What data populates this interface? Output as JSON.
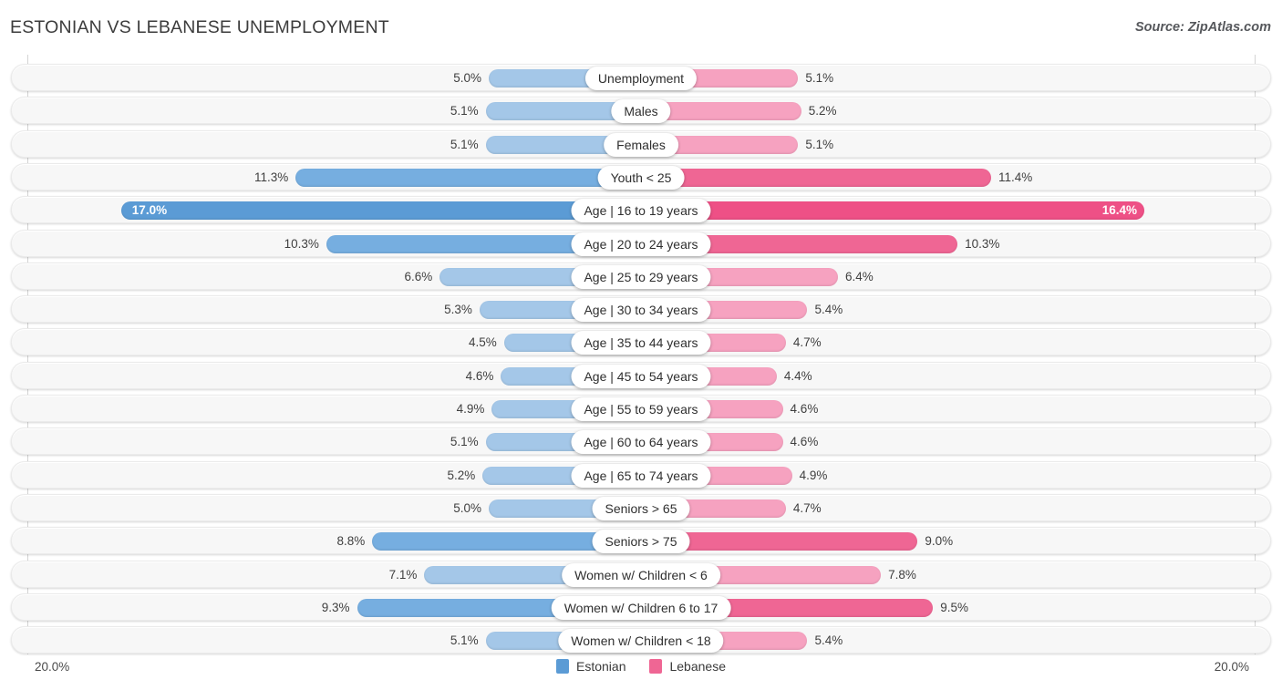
{
  "header": {
    "title": "ESTONIAN VS LEBANESE UNEMPLOYMENT",
    "source": "Source: ZipAtlas.com"
  },
  "axis": {
    "left_tick": "20.0%",
    "right_tick": "20.0%"
  },
  "legend": {
    "items": [
      {
        "label": "Estonian",
        "color": "#5b9bd5"
      },
      {
        "label": "Lebanese",
        "color": "#ef6694"
      }
    ]
  },
  "colors": {
    "estonian_light": "#a4c7e8",
    "estonian_dark": "#5b9bd5",
    "lebanese_light": "#f6a2c0",
    "lebanese_dark": "#ef6694",
    "lebanese_max": "#ee5086",
    "row_track": "#f7f7f7"
  },
  "chart_data": {
    "type": "bar",
    "subtype": "diverging-bidirectional",
    "title": "ESTONIAN VS LEBANESE UNEMPLOYMENT",
    "source": "Source: ZipAtlas.com",
    "xlabel": "",
    "ylabel": "",
    "xlim": [
      20.0,
      20.0
    ],
    "axis_max": 20.0,
    "unit": "%",
    "grid": true,
    "legend_position": "bottom-center",
    "categories": [
      "Unemployment",
      "Males",
      "Females",
      "Youth < 25",
      "Age | 16 to 19 years",
      "Age | 20 to 24 years",
      "Age | 25 to 29 years",
      "Age | 30 to 34 years",
      "Age | 35 to 44 years",
      "Age | 45 to 54 years",
      "Age | 55 to 59 years",
      "Age | 60 to 64 years",
      "Age | 65 to 74 years",
      "Seniors > 65",
      "Seniors > 75",
      "Women w/ Children < 6",
      "Women w/ Children 6 to 17",
      "Women w/ Children < 18"
    ],
    "series": [
      {
        "name": "Estonian",
        "color": "#5b9bd5",
        "side": "left",
        "values": [
          5.0,
          5.1,
          5.1,
          11.3,
          17.0,
          10.3,
          6.6,
          5.3,
          4.5,
          4.6,
          4.9,
          5.1,
          5.2,
          5.0,
          8.8,
          7.1,
          9.3,
          5.1
        ]
      },
      {
        "name": "Lebanese",
        "color": "#ef6694",
        "side": "right",
        "values": [
          5.1,
          5.2,
          5.1,
          11.4,
          16.4,
          10.3,
          6.4,
          5.4,
          4.7,
          4.4,
          4.6,
          4.6,
          4.9,
          4.7,
          9.0,
          7.8,
          9.5,
          5.4
        ]
      }
    ]
  },
  "rows": [
    {
      "label": "Unemployment",
      "left": "5.0%",
      "right": "5.1%",
      "lv": 5.0,
      "rv": 5.1,
      "emphasis": 0
    },
    {
      "label": "Males",
      "left": "5.1%",
      "right": "5.2%",
      "lv": 5.1,
      "rv": 5.2,
      "emphasis": 0
    },
    {
      "label": "Females",
      "left": "5.1%",
      "right": "5.1%",
      "lv": 5.1,
      "rv": 5.1,
      "emphasis": 0
    },
    {
      "label": "Youth < 25",
      "left": "11.3%",
      "right": "11.4%",
      "lv": 11.3,
      "rv": 11.4,
      "emphasis": 1
    },
    {
      "label": "Age | 16 to 19 years",
      "left": "17.0%",
      "right": "16.4%",
      "lv": 17.0,
      "rv": 16.4,
      "emphasis": 2
    },
    {
      "label": "Age | 20 to 24 years",
      "left": "10.3%",
      "right": "10.3%",
      "lv": 10.3,
      "rv": 10.3,
      "emphasis": 1
    },
    {
      "label": "Age | 25 to 29 years",
      "left": "6.6%",
      "right": "6.4%",
      "lv": 6.6,
      "rv": 6.4,
      "emphasis": 0
    },
    {
      "label": "Age | 30 to 34 years",
      "left": "5.3%",
      "right": "5.4%",
      "lv": 5.3,
      "rv": 5.4,
      "emphasis": 0
    },
    {
      "label": "Age | 35 to 44 years",
      "left": "4.5%",
      "right": "4.7%",
      "lv": 4.5,
      "rv": 4.7,
      "emphasis": 0
    },
    {
      "label": "Age | 45 to 54 years",
      "left": "4.6%",
      "right": "4.4%",
      "lv": 4.6,
      "rv": 4.4,
      "emphasis": 0
    },
    {
      "label": "Age | 55 to 59 years",
      "left": "4.9%",
      "right": "4.6%",
      "lv": 4.9,
      "rv": 4.6,
      "emphasis": 0
    },
    {
      "label": "Age | 60 to 64 years",
      "left": "5.1%",
      "right": "4.6%",
      "lv": 5.1,
      "rv": 4.6,
      "emphasis": 0
    },
    {
      "label": "Age | 65 to 74 years",
      "left": "5.2%",
      "right": "4.9%",
      "lv": 5.2,
      "rv": 4.9,
      "emphasis": 0
    },
    {
      "label": "Seniors > 65",
      "left": "5.0%",
      "right": "4.7%",
      "lv": 5.0,
      "rv": 4.7,
      "emphasis": 0
    },
    {
      "label": "Seniors > 75",
      "left": "8.8%",
      "right": "9.0%",
      "lv": 8.8,
      "rv": 9.0,
      "emphasis": 1
    },
    {
      "label": "Women w/ Children < 6",
      "left": "7.1%",
      "right": "7.8%",
      "lv": 7.1,
      "rv": 7.8,
      "emphasis": 0
    },
    {
      "label": "Women w/ Children 6 to 17",
      "left": "9.3%",
      "right": "9.5%",
      "lv": 9.3,
      "rv": 9.5,
      "emphasis": 1
    },
    {
      "label": "Women w/ Children < 18",
      "left": "5.1%",
      "right": "5.4%",
      "lv": 5.1,
      "rv": 5.4,
      "emphasis": 0
    }
  ]
}
